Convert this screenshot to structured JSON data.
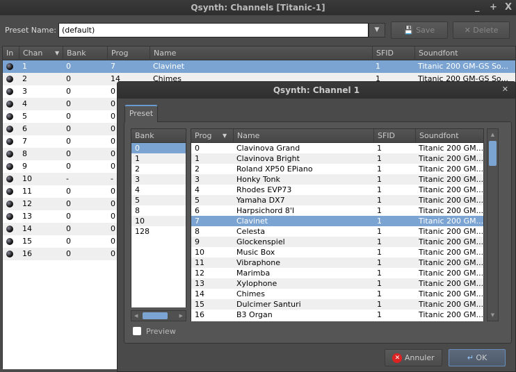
{
  "main": {
    "title": "Qsynth: Channels [Titanic-1]",
    "controls": [
      "_",
      "+",
      "X"
    ],
    "preset_label": "Preset Name:",
    "preset_value": "(default)",
    "save": "Save",
    "delete": "Delete",
    "columns": [
      "In",
      "Chan",
      "Bank",
      "Prog",
      "Name",
      "SFID",
      "Soundfont"
    ],
    "rows": [
      [
        "1",
        "0",
        "7",
        "Clavinet",
        "1",
        "Titanic 200 GM-GS So..."
      ],
      [
        "2",
        "0",
        "14",
        "Chimes",
        "1",
        "Titanic 200 GM-GS So..."
      ],
      [
        "3",
        "0",
        "0"
      ],
      [
        "4",
        "0",
        "0"
      ],
      [
        "5",
        "0",
        "0"
      ],
      [
        "6",
        "0",
        "0"
      ],
      [
        "7",
        "0",
        "0"
      ],
      [
        "8",
        "0",
        "0"
      ],
      [
        "9",
        "0",
        "0"
      ],
      [
        "10",
        "-",
        "-"
      ],
      [
        "11",
        "0",
        "0"
      ],
      [
        "12",
        "0",
        "0"
      ],
      [
        "13",
        "0",
        "0"
      ],
      [
        "14",
        "0",
        "0"
      ],
      [
        "15",
        "0",
        "0"
      ],
      [
        "16",
        "0",
        "0"
      ]
    ]
  },
  "dialog": {
    "title": "Qsynth: Channel 1",
    "close": "✕",
    "tab": "Preset",
    "bank_header": "Bank",
    "banks": [
      "0",
      "1",
      "2",
      "3",
      "4",
      "5",
      "8",
      "10",
      "128"
    ],
    "columns": [
      "Prog",
      "Name",
      "SFID",
      "Soundfont"
    ],
    "presets": [
      [
        "0",
        "Clavinova Grand"
      ],
      [
        "1",
        "Clavinova Bright"
      ],
      [
        "2",
        "Roland XP50 EPiano"
      ],
      [
        "3",
        "Honky Tonk"
      ],
      [
        "4",
        "Rhodes EVP73"
      ],
      [
        "5",
        "Yamaha DX7"
      ],
      [
        "6",
        "Harpsichord 8'I"
      ],
      [
        "7",
        "Clavinet"
      ],
      [
        "8",
        "Celesta"
      ],
      [
        "9",
        "Glockenspiel"
      ],
      [
        "10",
        "Music Box"
      ],
      [
        "11",
        "Vibraphone"
      ],
      [
        "12",
        "Marimba"
      ],
      [
        "13",
        "Xylophone"
      ],
      [
        "14",
        "Chimes"
      ],
      [
        "15",
        "Dulcimer Santuri"
      ],
      [
        "16",
        "B3 Organ"
      ]
    ],
    "sfid": "1",
    "soundfont": "Titanic 200 GM...",
    "preview": "Preview",
    "cancel": "Annuler",
    "ok": "OK"
  }
}
